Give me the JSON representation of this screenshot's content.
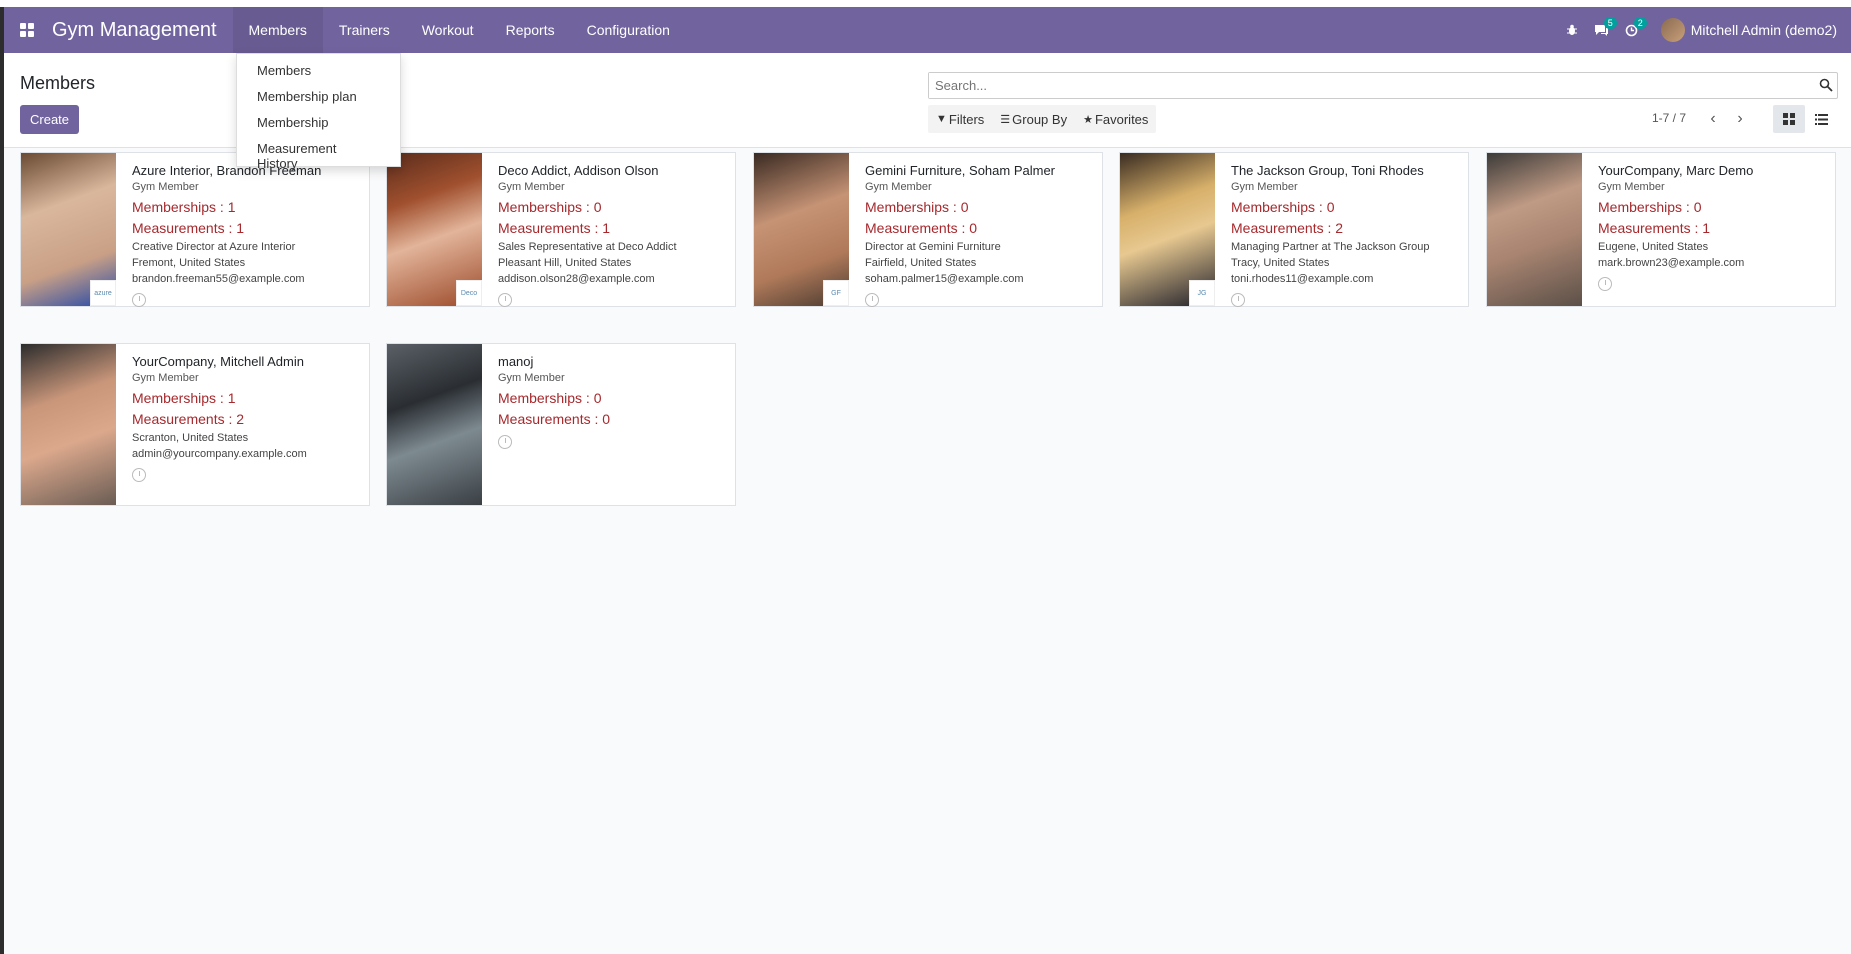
{
  "app": {
    "title": "Gym Management"
  },
  "nav": {
    "items": [
      {
        "label": "Members"
      },
      {
        "label": "Trainers"
      },
      {
        "label": "Workout"
      },
      {
        "label": "Reports"
      },
      {
        "label": "Configuration"
      }
    ],
    "messages_count": "5",
    "activities_count": "2",
    "user": "Mitchell Admin (demo2)"
  },
  "dropdown": {
    "items": [
      {
        "label": "Members"
      },
      {
        "label": "Membership plan"
      },
      {
        "label": "Membership"
      },
      {
        "label": "Measurement History"
      }
    ]
  },
  "control": {
    "breadcrumb": "Members",
    "create_label": "Create",
    "search_placeholder": "Search...",
    "filters_label": "Filters",
    "groupby_label": "Group By",
    "favorites_label": "Favorites",
    "pager": "1-7 / 7"
  },
  "colors": {
    "brand": "#71639e",
    "stat": "#a6292d"
  },
  "members": [
    {
      "name": "Azure Interior, Brandon Freeman",
      "tag": "Gym Member",
      "memberships": "Memberships : 1",
      "measurements": "Measurements : 1",
      "lines": [
        "Creative Director at Azure Interior",
        "Fremont, United States",
        "brandon.freeman55@example.com"
      ],
      "logo": "azure"
    },
    {
      "name": "Deco Addict, Addison Olson",
      "tag": "Gym Member",
      "memberships": "Memberships : 0",
      "measurements": "Measurements : 1",
      "lines": [
        "Sales Representative at Deco Addict",
        "Pleasant Hill, United States",
        "addison.olson28@example.com"
      ],
      "logo": "Deco"
    },
    {
      "name": "Gemini Furniture, Soham Palmer",
      "tag": "Gym Member",
      "memberships": "Memberships : 0",
      "measurements": "Measurements : 0",
      "lines": [
        "Director at Gemini Furniture",
        "Fairfield, United States",
        "soham.palmer15@example.com"
      ],
      "logo": "GF"
    },
    {
      "name": "The Jackson Group, Toni Rhodes",
      "tag": "Gym Member",
      "memberships": "Memberships : 0",
      "measurements": "Measurements : 2",
      "lines": [
        "Managing Partner at The Jackson Group",
        "Tracy, United States",
        "toni.rhodes11@example.com"
      ],
      "logo": "JG"
    },
    {
      "name": "YourCompany, Marc Demo",
      "tag": "Gym Member",
      "memberships": "Memberships : 0",
      "measurements": "Measurements : 1",
      "lines": [
        "Eugene, United States",
        "mark.brown23@example.com"
      ],
      "logo": ""
    },
    {
      "name": "YourCompany, Mitchell Admin",
      "tag": "Gym Member",
      "memberships": "Memberships : 1",
      "measurements": "Measurements : 2",
      "lines": [
        "Scranton, United States",
        "admin@yourcompany.example.com"
      ],
      "logo": ""
    },
    {
      "name": "manoj",
      "tag": "Gym Member",
      "memberships": "Memberships : 0",
      "measurements": "Measurements : 0",
      "lines": [],
      "logo": ""
    }
  ]
}
